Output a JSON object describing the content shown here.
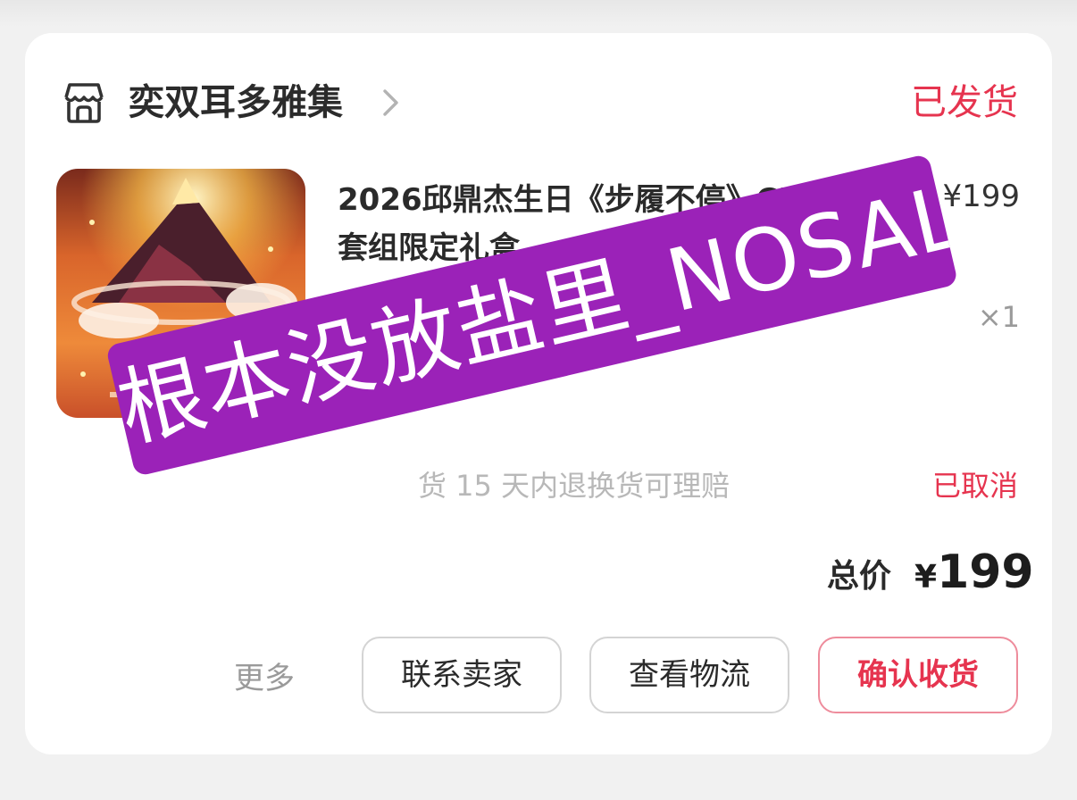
{
  "shop": {
    "icon": "shop-icon",
    "name": "奕双耳多雅集",
    "chevron": "chevron-right-icon",
    "order_status": "已发货"
  },
  "product": {
    "image": "product-thumbnail",
    "title_line1": "2026邱鼎杰生日《步履不停》CD",
    "title_line2": "套组限定礼盒",
    "price": "¥199",
    "quantity": "×1"
  },
  "service": {
    "text": "货 15 天内退换货可理赔",
    "status": "已取消"
  },
  "total": {
    "label": "总价",
    "currency": "¥",
    "amount": "199"
  },
  "actions": {
    "more": "更多",
    "contact_seller": "联系卖家",
    "view_logistics": "查看物流",
    "confirm_receipt": "确认收货"
  },
  "watermark": {
    "text": "根本没放盐里_NOSALT"
  },
  "colors": {
    "accent": "#e6344f",
    "watermark_bg": "#9b22b8"
  }
}
